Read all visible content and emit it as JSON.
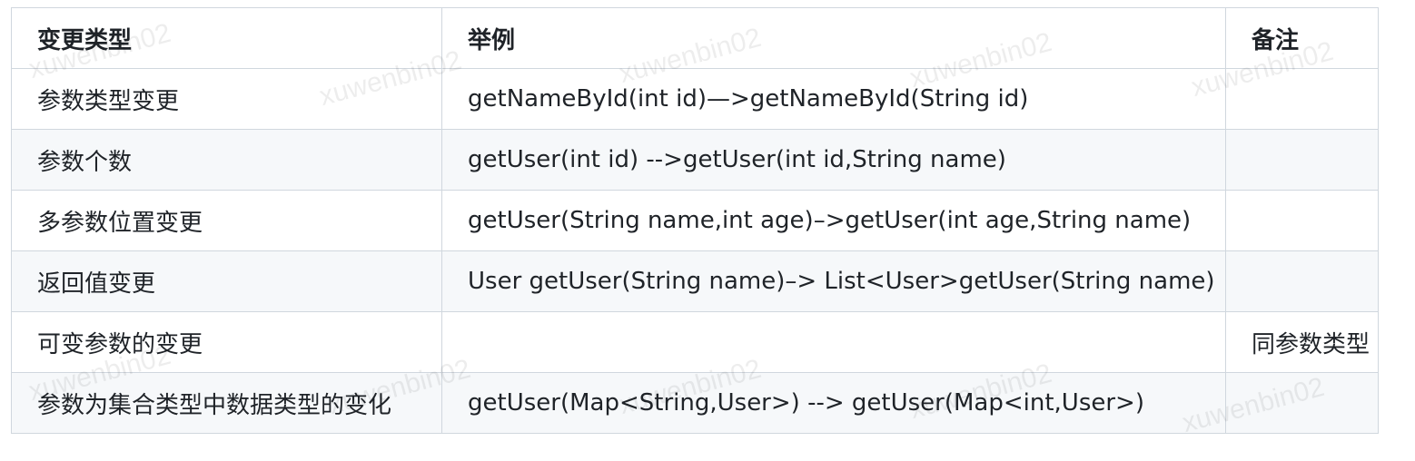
{
  "table": {
    "headers": [
      "变更类型",
      "举例",
      "备注"
    ],
    "rows": [
      [
        "参数类型变更",
        "getNameById(int id)—>getNameById(String id)",
        ""
      ],
      [
        "参数个数",
        "getUser(int id) -->getUser(int id,String name)",
        ""
      ],
      [
        "多参数位置变更",
        "getUser(String name,int age)–>getUser(int age,String name)",
        ""
      ],
      [
        "返回值变更",
        "User getUser(String name)–> List<User>getUser(String name)",
        ""
      ],
      [
        "可变参数的变更",
        "",
        "同参数类型"
      ],
      [
        "参数为集合类型中数据类型的变化",
        "getUser(Map<String,User>) --> getUser(Map<int,User>)",
        ""
      ]
    ]
  },
  "watermark": {
    "text": "xuwenbin02"
  }
}
